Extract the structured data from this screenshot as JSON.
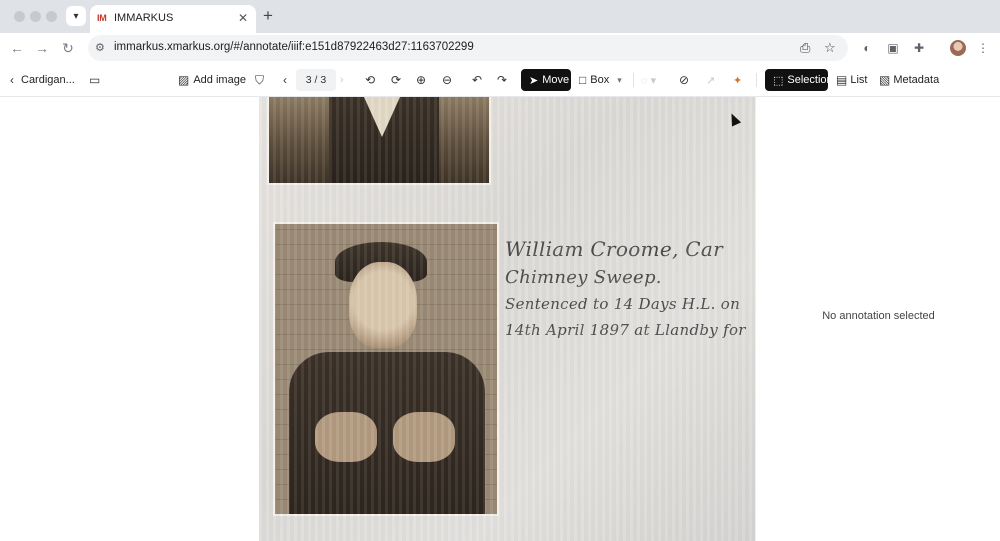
{
  "browser": {
    "tab_title": "IMMARKUS",
    "tab_favicon": "IM",
    "url": "immarkus.xmarkus.org/#/annotate/iiif:e151d87922463d27:1163702299",
    "accent": "#c0392b"
  },
  "toolbar": {
    "back_label": "Cardigan...",
    "add_image_label": "Add image",
    "pager": "3 / 3",
    "move_label": "Move",
    "box_label": "Box",
    "selection_label": "Selection",
    "list_label": "List",
    "metadata_label": "Metadata"
  },
  "document": {
    "line1": "William Croome, Car",
    "line2": "Chimney Sweep.",
    "line3": "Sentenced to 14 Days H.L. on",
    "line4": "14th April 1897 at Llandby for"
  },
  "right_panel": {
    "empty_text": "No annotation selected"
  }
}
